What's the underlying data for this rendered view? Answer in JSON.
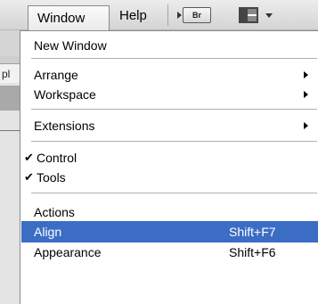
{
  "menubar": {
    "menus": [
      {
        "label": "Window"
      },
      {
        "label": "Help"
      }
    ],
    "icons": [
      "bridge-icon",
      "workspace-layout-icon"
    ],
    "bridge_label": "Br"
  },
  "background": {
    "tab_label": "pl"
  },
  "dropdown": {
    "items": [
      {
        "label": "New Window"
      },
      {
        "label": "Arrange",
        "submenu": true
      },
      {
        "label": "Workspace",
        "submenu": true
      },
      {
        "label": "Extensions",
        "submenu": true
      },
      {
        "label": "Control",
        "checked": true
      },
      {
        "label": "Tools",
        "checked": true
      },
      {
        "label": "Actions"
      },
      {
        "label": "Align",
        "shortcut": "Shift+F7",
        "highlighted": true
      },
      {
        "label": "Appearance",
        "shortcut": "Shift+F6"
      }
    ],
    "check_glyph": "✔"
  },
  "colors": {
    "highlight": "#3c6dc5",
    "menu_background": "#ffffff"
  }
}
